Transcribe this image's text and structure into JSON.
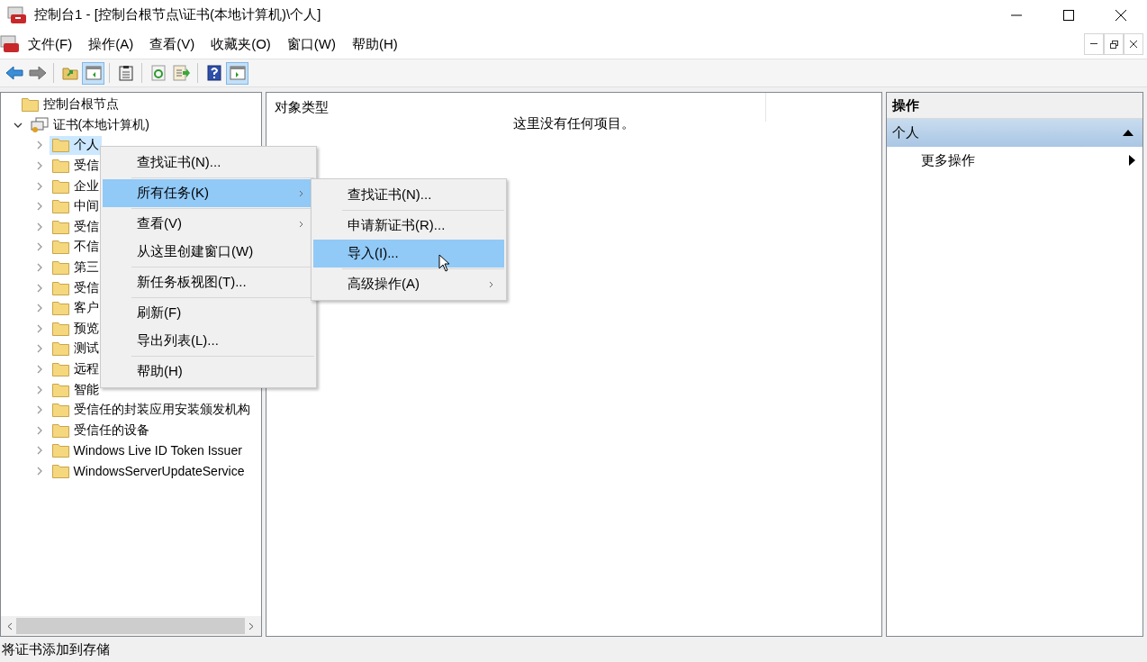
{
  "window": {
    "title": "控制台1 - [控制台根节点\\证书(本地计算机)\\个人]"
  },
  "menu_bar": [
    "文件(F)",
    "操作(A)",
    "查看(V)",
    "收藏夹(O)",
    "窗口(W)",
    "帮助(H)"
  ],
  "toolbar": [
    [
      {
        "kind": "back",
        "pressed": false
      },
      {
        "kind": "forward",
        "pressed": false
      }
    ],
    [
      {
        "kind": "up",
        "pressed": false
      },
      {
        "kind": "tree",
        "pressed": true
      }
    ],
    [
      {
        "kind": "properties",
        "pressed": false
      }
    ],
    [
      {
        "kind": "refresh",
        "pressed": false
      },
      {
        "kind": "export",
        "pressed": false
      }
    ],
    [
      {
        "kind": "help",
        "pressed": false
      },
      {
        "kind": "actions",
        "pressed": true
      }
    ]
  ],
  "tree": [
    {
      "label": "控制台根节点",
      "kind": "folder",
      "selected": false,
      "children": [
        {
          "label": "证书(本地计算机)",
          "kind": "certificates",
          "selected": false,
          "expanded": true,
          "children": [
            {
              "label": "个人",
              "kind": "folder",
              "selected": true,
              "expanded": false
            },
            {
              "label": "受信",
              "kind": "folder",
              "selected": false,
              "expanded": false
            },
            {
              "label": "企业",
              "kind": "folder",
              "selected": false,
              "expanded": false
            },
            {
              "label": "中间",
              "kind": "folder",
              "selected": false,
              "expanded": false
            },
            {
              "label": "受信",
              "kind": "folder",
              "selected": false,
              "expanded": false
            },
            {
              "label": "不信",
              "kind": "folder",
              "selected": false,
              "expanded": false
            },
            {
              "label": "第三",
              "kind": "folder",
              "selected": false,
              "expanded": false
            },
            {
              "label": "受信",
              "kind": "folder",
              "selected": false,
              "expanded": false
            },
            {
              "label": "客户",
              "kind": "folder",
              "selected": false,
              "expanded": false
            },
            {
              "label": "预览",
              "kind": "folder",
              "selected": false,
              "expanded": false
            },
            {
              "label": "测试",
              "kind": "folder",
              "selected": false,
              "expanded": false
            },
            {
              "label": "远程",
              "kind": "folder",
              "selected": false,
              "expanded": false
            },
            {
              "label": "智能",
              "kind": "folder",
              "selected": false,
              "expanded": false
            },
            {
              "label": "受信任的封装应用安装颁发机构",
              "kind": "folder",
              "selected": false,
              "expanded": false
            },
            {
              "label": "受信任的设备",
              "kind": "folder",
              "selected": false,
              "expanded": false
            },
            {
              "label": "Windows Live ID Token Issuer",
              "kind": "folder",
              "selected": false,
              "expanded": false
            },
            {
              "label": "WindowsServerUpdateService",
              "kind": "folder",
              "selected": false,
              "expanded": false
            }
          ]
        }
      ]
    }
  ],
  "content": {
    "columns": [
      "对象类型"
    ],
    "empty_message": "这里没有任何项目。"
  },
  "actions": {
    "title": "操作",
    "section": {
      "label": "个人",
      "expanded": true
    },
    "items": [
      {
        "label": "更多操作",
        "submenu": true
      }
    ]
  },
  "context_menu": [
    {
      "kind": "item",
      "label": "查找证书(N)...",
      "selected": false,
      "submenu": false
    },
    {
      "kind": "separator"
    },
    {
      "kind": "item",
      "label": "所有任务(K)",
      "selected": true,
      "submenu": true
    },
    {
      "kind": "separator"
    },
    {
      "kind": "item",
      "label": "查看(V)",
      "selected": false,
      "submenu": true
    },
    {
      "kind": "item",
      "label": "从这里创建窗口(W)",
      "selected": false,
      "submenu": false
    },
    {
      "kind": "separator"
    },
    {
      "kind": "item",
      "label": "新任务板视图(T)...",
      "selected": false,
      "submenu": false
    },
    {
      "kind": "separator"
    },
    {
      "kind": "item",
      "label": "刷新(F)",
      "selected": false,
      "submenu": false
    },
    {
      "kind": "item",
      "label": "导出列表(L)...",
      "selected": false,
      "submenu": false
    },
    {
      "kind": "separator"
    },
    {
      "kind": "item",
      "label": "帮助(H)",
      "selected": false,
      "submenu": false
    }
  ],
  "submenu": [
    {
      "kind": "item",
      "label": "查找证书(N)...",
      "selected": false,
      "submenu": false
    },
    {
      "kind": "separator"
    },
    {
      "kind": "item",
      "label": "申请新证书(R)...",
      "selected": false,
      "submenu": false
    },
    {
      "kind": "item",
      "label": "导入(I)...",
      "selected": true,
      "submenu": false
    },
    {
      "kind": "separator"
    },
    {
      "kind": "item",
      "label": "高级操作(A)",
      "selected": false,
      "submenu": true
    }
  ],
  "status_bar": {
    "text": "将证书添加到存储"
  }
}
